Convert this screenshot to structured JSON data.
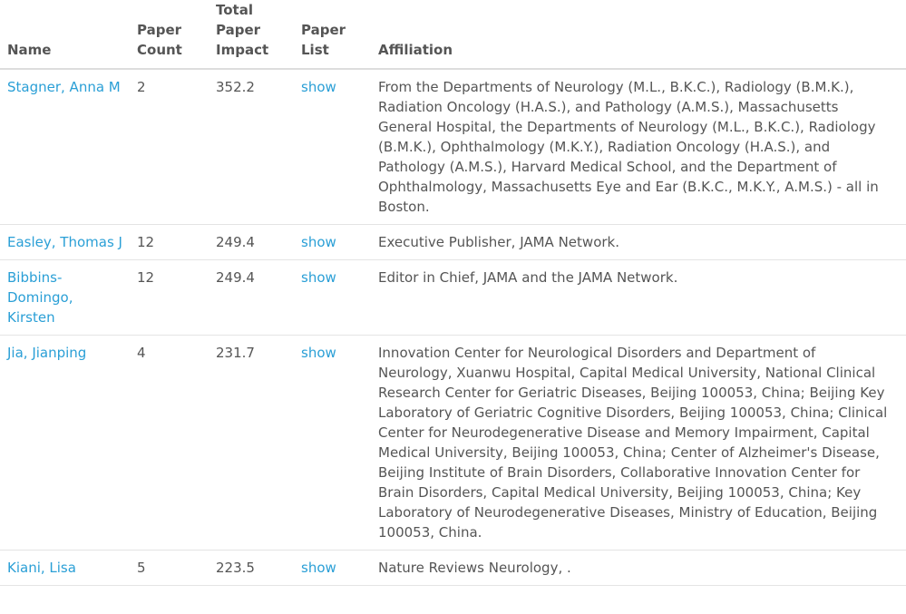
{
  "columns": {
    "name": "Name",
    "paper_count": "Paper Count",
    "total_paper_impact": "Total Paper Impact",
    "paper_list": "Paper List",
    "affiliation": "Affiliation"
  },
  "rows": [
    {
      "name": "Stagner, Anna M",
      "paper_count": "2",
      "impact": "352.2",
      "list_link": "show",
      "affiliation": "From the Departments of Neurology (M.L., B.K.C.), Radiology (B.M.K.), Radiation Oncology (H.A.S.), and Pathology (A.M.S.), Massachusetts General Hospital, the Departments of Neurology (M.L., B.K.C.), Radiology (B.M.K.), Ophthalmology (M.K.Y.), Radiation Oncology (H.A.S.), and Pathology (A.M.S.), Harvard Medical School, and the Department of Ophthalmology, Massachusetts Eye and Ear (B.K.C., M.K.Y., A.M.S.) - all in Boston."
    },
    {
      "name": "Easley, Thomas J",
      "paper_count": "12",
      "impact": "249.4",
      "list_link": "show",
      "affiliation": "Executive Publisher, JAMA Network."
    },
    {
      "name": "Bibbins-Domingo, Kirsten",
      "paper_count": "12",
      "impact": "249.4",
      "list_link": "show",
      "affiliation": "Editor in Chief, JAMA and the JAMA Network."
    },
    {
      "name": "Jia, Jianping",
      "paper_count": "4",
      "impact": "231.7",
      "list_link": "show",
      "affiliation": "Innovation Center for Neurological Disorders and Department of Neurology, Xuanwu Hospital, Capital Medical University, National Clinical Research Center for Geriatric Diseases, Beijing 100053, China; Beijing Key Laboratory of Geriatric Cognitive Disorders, Beijing 100053, China; Clinical Center for Neurodegenerative Disease and Memory Impairment, Capital Medical University, Beijing 100053, China; Center of Alzheimer's Disease, Beijing Institute of Brain Disorders, Collaborative Innovation Center for Brain Disorders, Capital Medical University, Beijing 100053, China; Key Laboratory of Neurodegenerative Diseases, Ministry of Education, Beijing 100053, China."
    },
    {
      "name": "Kiani, Lisa",
      "paper_count": "5",
      "impact": "223.5",
      "list_link": "show",
      "affiliation": "Nature Reviews Neurology, ."
    }
  ]
}
